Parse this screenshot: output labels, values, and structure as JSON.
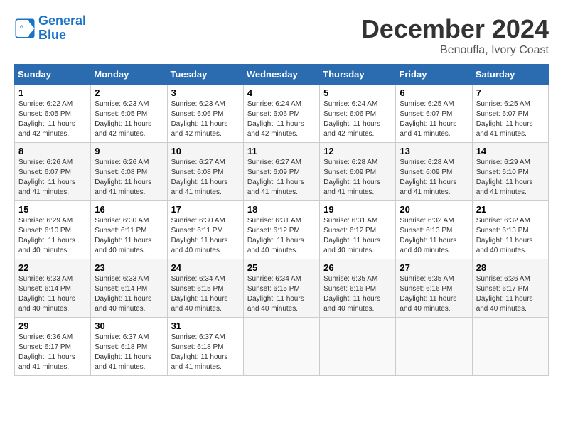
{
  "header": {
    "logo_line1": "General",
    "logo_line2": "Blue",
    "month": "December 2024",
    "location": "Benoufla, Ivory Coast"
  },
  "days_of_week": [
    "Sunday",
    "Monday",
    "Tuesday",
    "Wednesday",
    "Thursday",
    "Friday",
    "Saturday"
  ],
  "weeks": [
    [
      {
        "day": "1",
        "sunrise": "6:22 AM",
        "sunset": "6:05 PM",
        "daylight": "11 hours and 42 minutes."
      },
      {
        "day": "2",
        "sunrise": "6:23 AM",
        "sunset": "6:05 PM",
        "daylight": "11 hours and 42 minutes."
      },
      {
        "day": "3",
        "sunrise": "6:23 AM",
        "sunset": "6:06 PM",
        "daylight": "11 hours and 42 minutes."
      },
      {
        "day": "4",
        "sunrise": "6:24 AM",
        "sunset": "6:06 PM",
        "daylight": "11 hours and 42 minutes."
      },
      {
        "day": "5",
        "sunrise": "6:24 AM",
        "sunset": "6:06 PM",
        "daylight": "11 hours and 42 minutes."
      },
      {
        "day": "6",
        "sunrise": "6:25 AM",
        "sunset": "6:07 PM",
        "daylight": "11 hours and 41 minutes."
      },
      {
        "day": "7",
        "sunrise": "6:25 AM",
        "sunset": "6:07 PM",
        "daylight": "11 hours and 41 minutes."
      }
    ],
    [
      {
        "day": "8",
        "sunrise": "6:26 AM",
        "sunset": "6:07 PM",
        "daylight": "11 hours and 41 minutes."
      },
      {
        "day": "9",
        "sunrise": "6:26 AM",
        "sunset": "6:08 PM",
        "daylight": "11 hours and 41 minutes."
      },
      {
        "day": "10",
        "sunrise": "6:27 AM",
        "sunset": "6:08 PM",
        "daylight": "11 hours and 41 minutes."
      },
      {
        "day": "11",
        "sunrise": "6:27 AM",
        "sunset": "6:09 PM",
        "daylight": "11 hours and 41 minutes."
      },
      {
        "day": "12",
        "sunrise": "6:28 AM",
        "sunset": "6:09 PM",
        "daylight": "11 hours and 41 minutes."
      },
      {
        "day": "13",
        "sunrise": "6:28 AM",
        "sunset": "6:09 PM",
        "daylight": "11 hours and 41 minutes."
      },
      {
        "day": "14",
        "sunrise": "6:29 AM",
        "sunset": "6:10 PM",
        "daylight": "11 hours and 41 minutes."
      }
    ],
    [
      {
        "day": "15",
        "sunrise": "6:29 AM",
        "sunset": "6:10 PM",
        "daylight": "11 hours and 40 minutes."
      },
      {
        "day": "16",
        "sunrise": "6:30 AM",
        "sunset": "6:11 PM",
        "daylight": "11 hours and 40 minutes."
      },
      {
        "day": "17",
        "sunrise": "6:30 AM",
        "sunset": "6:11 PM",
        "daylight": "11 hours and 40 minutes."
      },
      {
        "day": "18",
        "sunrise": "6:31 AM",
        "sunset": "6:12 PM",
        "daylight": "11 hours and 40 minutes."
      },
      {
        "day": "19",
        "sunrise": "6:31 AM",
        "sunset": "6:12 PM",
        "daylight": "11 hours and 40 minutes."
      },
      {
        "day": "20",
        "sunrise": "6:32 AM",
        "sunset": "6:13 PM",
        "daylight": "11 hours and 40 minutes."
      },
      {
        "day": "21",
        "sunrise": "6:32 AM",
        "sunset": "6:13 PM",
        "daylight": "11 hours and 40 minutes."
      }
    ],
    [
      {
        "day": "22",
        "sunrise": "6:33 AM",
        "sunset": "6:14 PM",
        "daylight": "11 hours and 40 minutes."
      },
      {
        "day": "23",
        "sunrise": "6:33 AM",
        "sunset": "6:14 PM",
        "daylight": "11 hours and 40 minutes."
      },
      {
        "day": "24",
        "sunrise": "6:34 AM",
        "sunset": "6:15 PM",
        "daylight": "11 hours and 40 minutes."
      },
      {
        "day": "25",
        "sunrise": "6:34 AM",
        "sunset": "6:15 PM",
        "daylight": "11 hours and 40 minutes."
      },
      {
        "day": "26",
        "sunrise": "6:35 AM",
        "sunset": "6:16 PM",
        "daylight": "11 hours and 40 minutes."
      },
      {
        "day": "27",
        "sunrise": "6:35 AM",
        "sunset": "6:16 PM",
        "daylight": "11 hours and 40 minutes."
      },
      {
        "day": "28",
        "sunrise": "6:36 AM",
        "sunset": "6:17 PM",
        "daylight": "11 hours and 40 minutes."
      }
    ],
    [
      {
        "day": "29",
        "sunrise": "6:36 AM",
        "sunset": "6:17 PM",
        "daylight": "11 hours and 41 minutes."
      },
      {
        "day": "30",
        "sunrise": "6:37 AM",
        "sunset": "6:18 PM",
        "daylight": "11 hours and 41 minutes."
      },
      {
        "day": "31",
        "sunrise": "6:37 AM",
        "sunset": "6:18 PM",
        "daylight": "11 hours and 41 minutes."
      },
      null,
      null,
      null,
      null
    ]
  ]
}
